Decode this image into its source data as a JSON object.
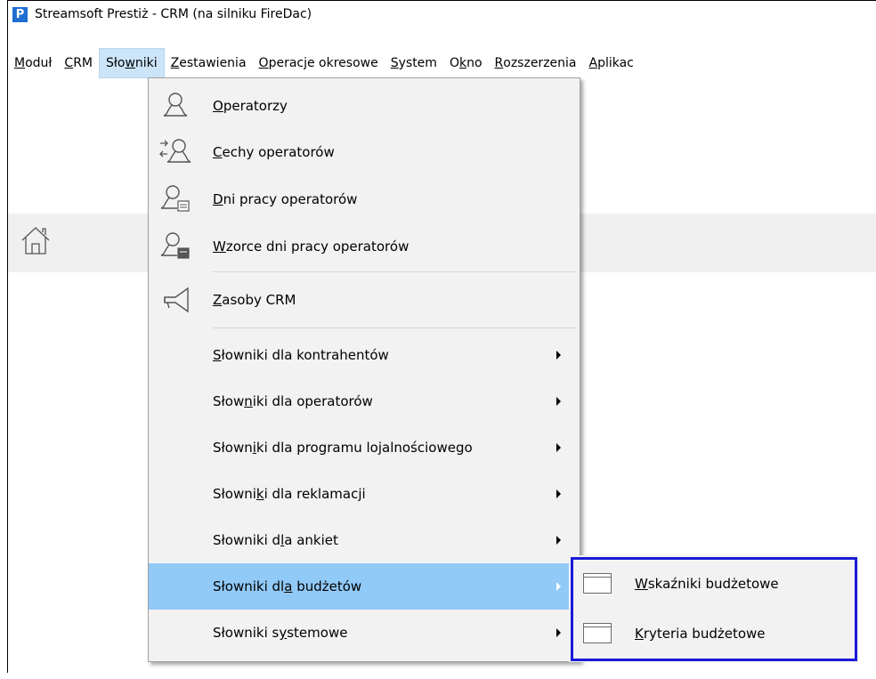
{
  "app": {
    "title": "Streamsoft Prestiż - CRM (na silniku FireDac)",
    "logo_letter": "P",
    "brand_color": "#1f6fd1"
  },
  "menubar": [
    {
      "key": "modul",
      "pre": "",
      "u": "M",
      "post": "oduł"
    },
    {
      "key": "crm",
      "pre": "",
      "u": "C",
      "post": "RM"
    },
    {
      "key": "slowniki",
      "pre": "Sło",
      "u": "w",
      "post": "niki"
    },
    {
      "key": "zestawienia",
      "pre": "",
      "u": "Z",
      "post": "estawienia"
    },
    {
      "key": "operacje",
      "pre": "",
      "u": "O",
      "post": "peracje okresowe"
    },
    {
      "key": "system",
      "pre": "",
      "u": "S",
      "post": "ystem"
    },
    {
      "key": "okno",
      "pre": "O",
      "u": "k",
      "post": "no"
    },
    {
      "key": "rozszerzenia",
      "pre": "",
      "u": "R",
      "post": "ozszerzenia"
    },
    {
      "key": "aplikacje",
      "pre": "",
      "u": "A",
      "post": "plikac"
    }
  ],
  "dropdown": {
    "items": [
      {
        "pre": "",
        "u": "O",
        "post": "peratorzy",
        "icon": "operator-icon"
      },
      {
        "pre": "",
        "u": "C",
        "post": "echy operatorów",
        "icon": "operator-features-icon"
      },
      {
        "pre": "",
        "u": "D",
        "post": "ni pracy operatorów",
        "icon": "operator-workdays-icon"
      },
      {
        "pre": "",
        "u": "W",
        "post": "zorce dni pracy operatorów",
        "icon": "workday-templates-icon"
      },
      {
        "pre": "",
        "u": "Z",
        "post": "asoby CRM",
        "icon": "megaphone-icon"
      },
      {
        "pre": "",
        "u": "S",
        "post": "łowniki dla kontrahentów",
        "submenu": true
      },
      {
        "pre": "Słow",
        "u": "n",
        "post": "iki dla operatorów",
        "submenu": true
      },
      {
        "pre": "Słown",
        "u": "i",
        "post": "ki dla programu lojalnościowego",
        "submenu": true
      },
      {
        "pre": "Słowni",
        "u": "k",
        "post": "i dla reklamacji",
        "submenu": true
      },
      {
        "pre": "Słowniki d",
        "u": "l",
        "post": "a ankiet",
        "submenu": true
      },
      {
        "pre": "Słowniki dl",
        "u": "a",
        "post": " budżetów",
        "submenu": true,
        "highlighted": true
      },
      {
        "pre": "Słowniki s",
        "u": "y",
        "post": "stemowe",
        "submenu": true
      }
    ]
  },
  "submenu": {
    "items": [
      {
        "pre": "",
        "u": "W",
        "post": "skaźniki budżetowe",
        "icon": "window-icon"
      },
      {
        "pre": "",
        "u": "K",
        "post": "ryteria budżetowe",
        "icon": "window-icon"
      }
    ],
    "highlight_color": "#1a1ad8"
  },
  "colors": {
    "menu_highlight": "#91c9f7",
    "menubar_active": "#cce4f7"
  }
}
